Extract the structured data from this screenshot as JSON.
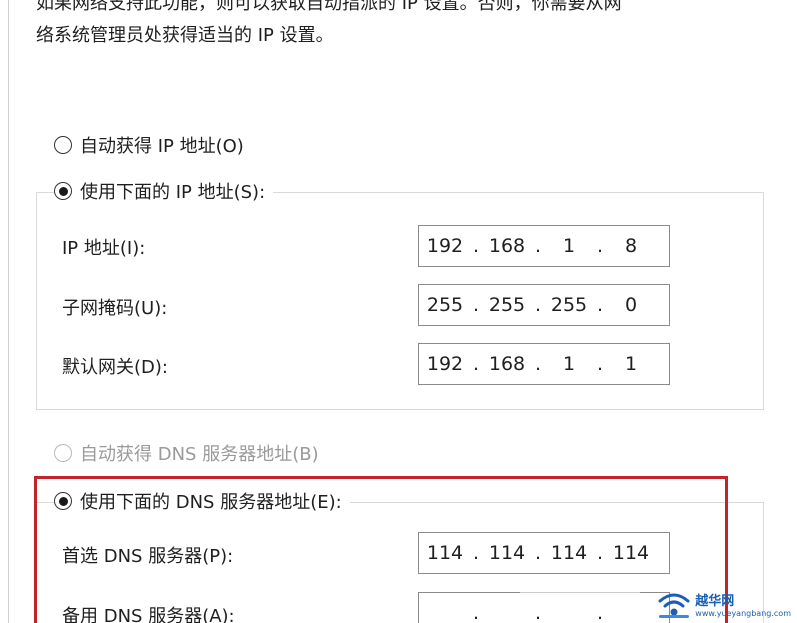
{
  "intro": {
    "line1": "如果网络支持此功能，则可以获取自动指派的 IP 设置。否则，你需要从网",
    "line2": "络系统管理员处获得适当的 IP 设置。"
  },
  "ip_mode": {
    "auto_label": "自动获得 IP 地址(O)",
    "manual_label": "使用下面的 IP 地址(S):",
    "selected": "manual"
  },
  "ip_fields": [
    {
      "label": "IP 地址(I):",
      "octets": [
        "192",
        "168",
        "1",
        "8"
      ]
    },
    {
      "label": "子网掩码(U):",
      "octets": [
        "255",
        "255",
        "255",
        "0"
      ]
    },
    {
      "label": "默认网关(D):",
      "octets": [
        "192",
        "168",
        "1",
        "1"
      ]
    }
  ],
  "dns_mode": {
    "auto_label": "自动获得 DNS 服务器地址(B)",
    "manual_label": "使用下面的 DNS 服务器地址(E):",
    "selected": "manual"
  },
  "dns_fields": [
    {
      "label": "首选 DNS 服务器(P):",
      "octets": [
        "114",
        "114",
        "114",
        "114"
      ]
    },
    {
      "label": "备用 DNS 服务器(A):",
      "octets": [
        "",
        "",
        "",
        ""
      ]
    }
  ],
  "separator": ".",
  "watermark": {
    "title": "越华网",
    "url": "www.yueyangbang.com"
  },
  "colors": {
    "highlight_frame": "#c4232b",
    "watermark": "#1a5fb4"
  }
}
